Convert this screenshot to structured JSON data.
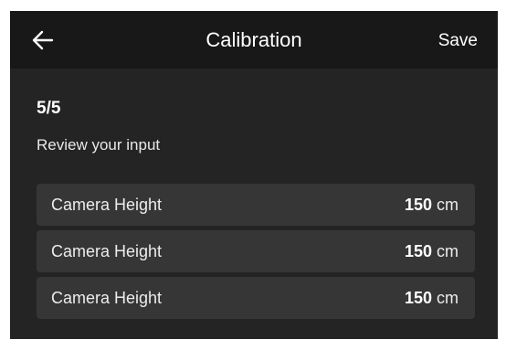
{
  "header": {
    "title": "Calibration",
    "save_label": "Save",
    "back_icon": "arrow-left-icon"
  },
  "step": "5/5",
  "subtitle": "Review your input",
  "rows": [
    {
      "label": "Camera Height",
      "value": "150",
      "unit": "cm"
    },
    {
      "label": "Camera Height",
      "value": "150",
      "unit": "cm"
    },
    {
      "label": "Camera Height",
      "value": "150",
      "unit": "cm"
    }
  ]
}
